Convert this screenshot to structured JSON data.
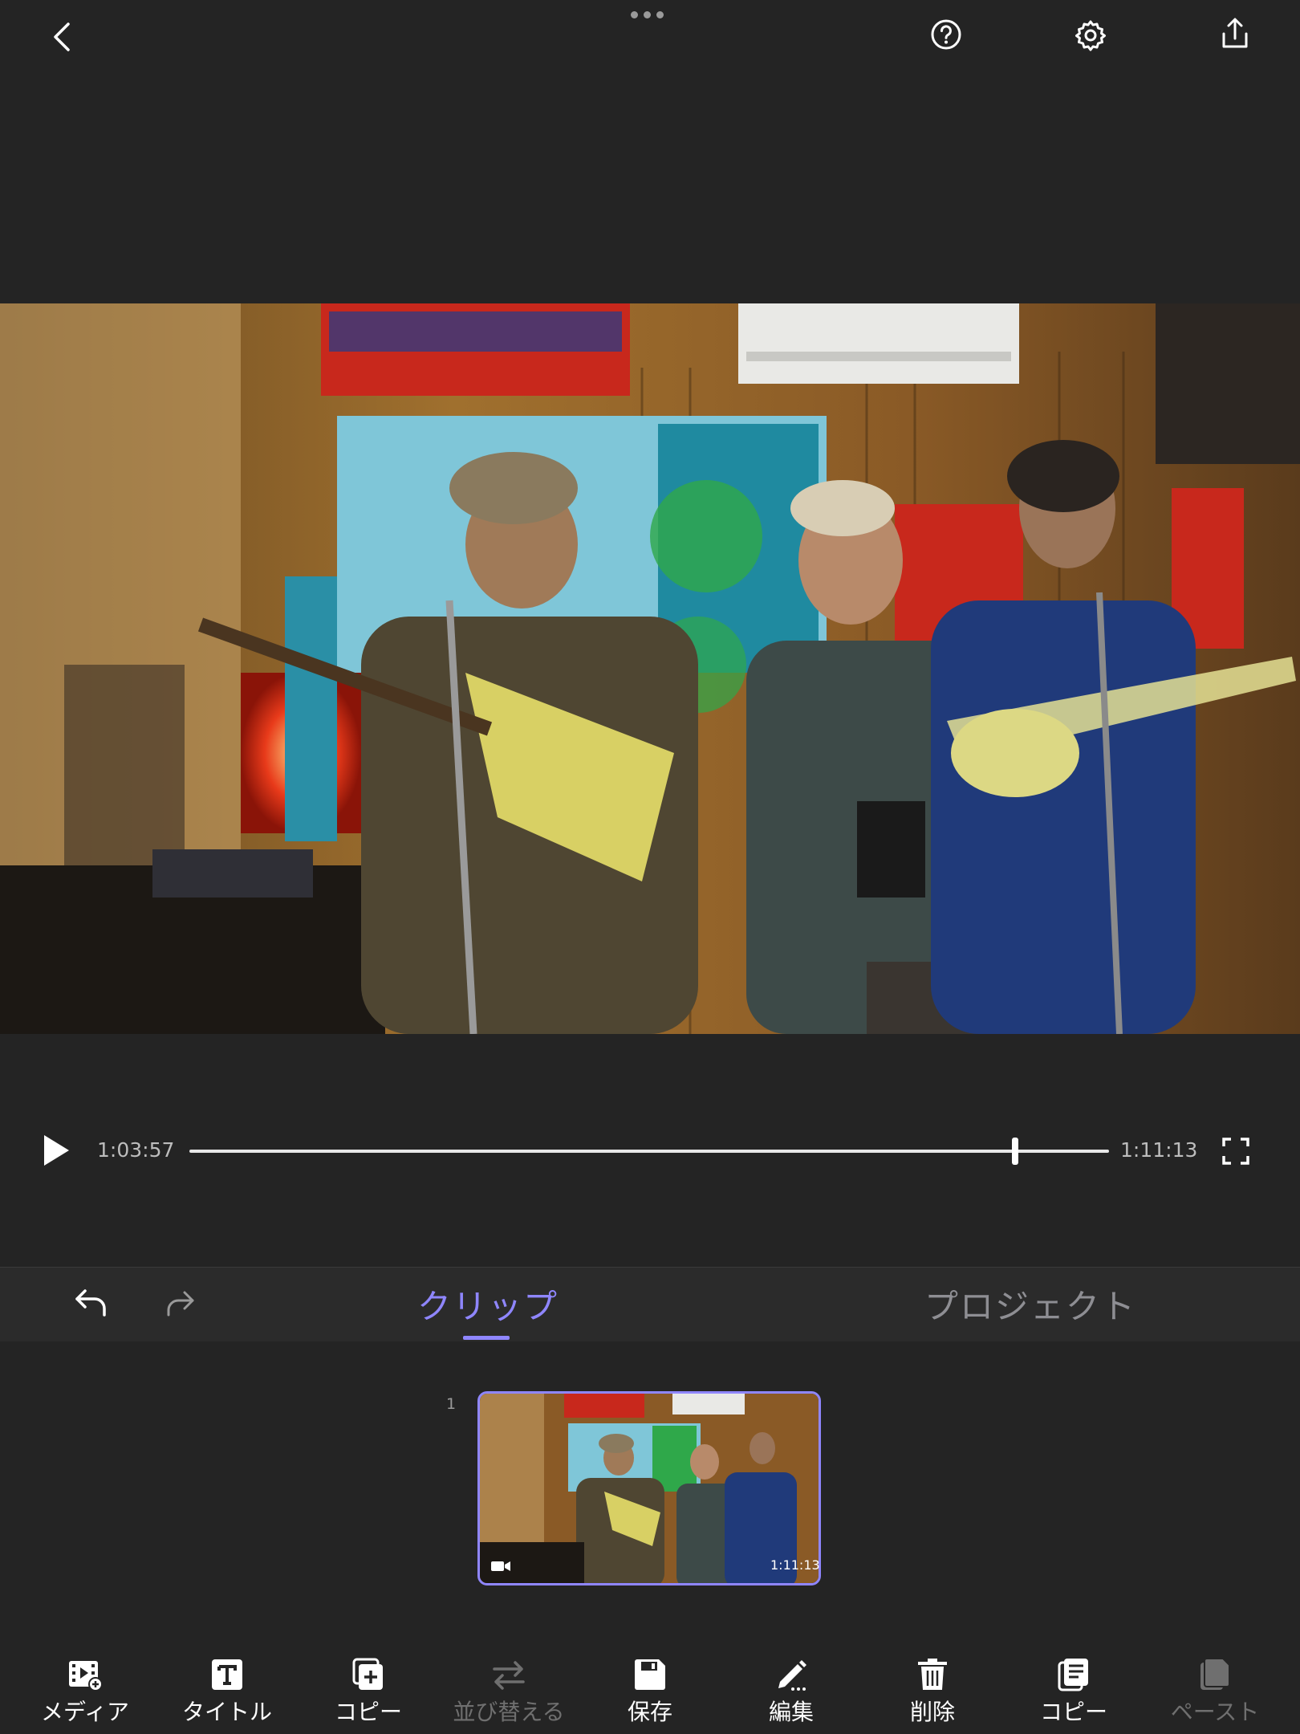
{
  "playback": {
    "current_time": "1:03:57",
    "total_time": "1:11:13",
    "progress": 0.898
  },
  "edit_bar": {
    "tabs": [
      {
        "label": "クリップ",
        "active": true
      },
      {
        "label": "プロジェクト",
        "active": false
      }
    ]
  },
  "timeline": {
    "clips": [
      {
        "index": "1",
        "duration": "1:11:13",
        "selected": true
      }
    ]
  },
  "toolbar": {
    "items": [
      {
        "label": "メディア",
        "icon": "media-add-icon",
        "enabled": true
      },
      {
        "label": "タイトル",
        "icon": "title-icon",
        "enabled": true
      },
      {
        "label": "コピー",
        "icon": "duplicate-icon",
        "enabled": true
      },
      {
        "label": "並び替える",
        "icon": "reorder-icon",
        "enabled": false
      },
      {
        "label": "保存",
        "icon": "save-icon",
        "enabled": true
      },
      {
        "label": "編集",
        "icon": "edit-icon",
        "enabled": true
      },
      {
        "label": "削除",
        "icon": "trash-icon",
        "enabled": true
      },
      {
        "label": "コピー",
        "icon": "copy-icon",
        "enabled": true
      },
      {
        "label": "ペースト",
        "icon": "paste-icon",
        "enabled": false
      }
    ]
  },
  "colors": {
    "background": "#242424",
    "accent": "#8f86ff",
    "inactive_tab": "#8e8e93",
    "disabled": "#6f6f6f"
  }
}
